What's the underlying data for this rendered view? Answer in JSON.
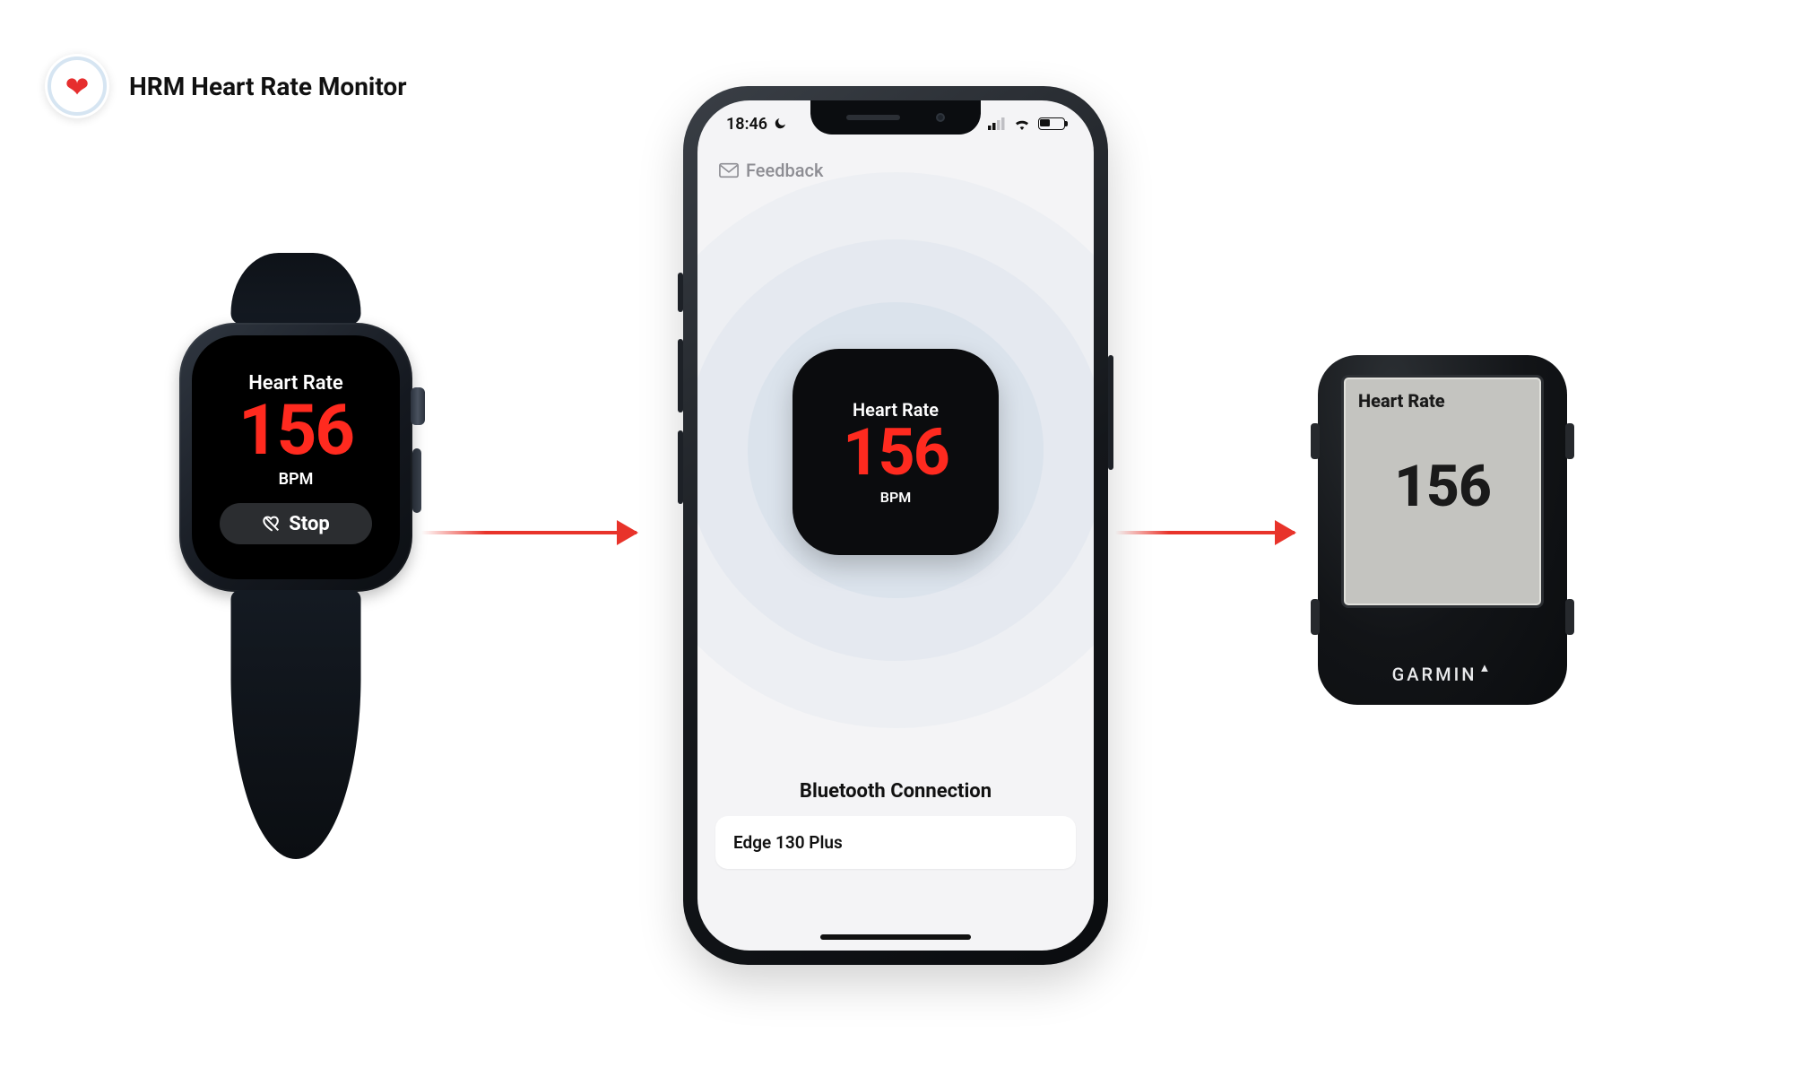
{
  "header": {
    "title": "HRM Heart Rate Monitor"
  },
  "watch": {
    "hr_label": "Heart Rate",
    "hr_value": "156",
    "bpm_label": "BPM",
    "stop_label": "Stop"
  },
  "phone": {
    "status": {
      "time": "18:46"
    },
    "feedback_label": "Feedback",
    "hr_label": "Heart Rate",
    "hr_value": "156",
    "bpm_label": "BPM",
    "bt_section_title": "Bluetooth Connection",
    "bt_device": "Edge 130 Plus"
  },
  "garmin": {
    "hr_label": "Heart Rate",
    "hr_value": "156",
    "brand": "GARMIN"
  }
}
